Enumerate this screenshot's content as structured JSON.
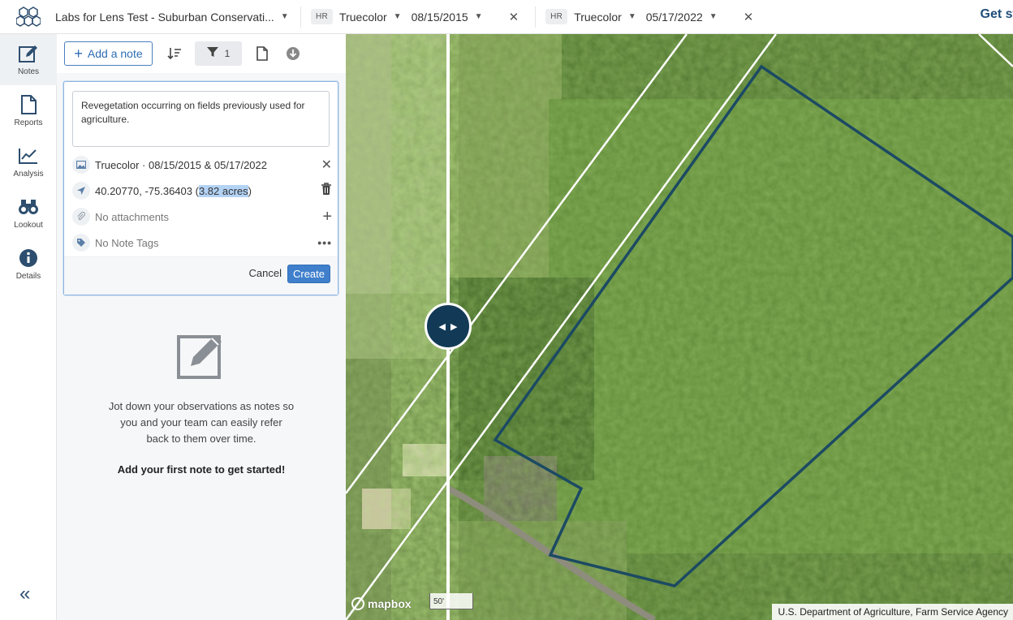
{
  "header": {
    "project_name": "Labs for Lens Test - Suburban Conservati...",
    "get_started": "Get star",
    "layers": [
      {
        "badge": "HR",
        "name": "Truecolor",
        "date": "08/15/2015"
      },
      {
        "badge": "HR",
        "name": "Truecolor",
        "date": "05/17/2022"
      }
    ]
  },
  "rail": {
    "items": [
      {
        "label": "Notes",
        "icon": "pencil-square-icon",
        "active": true
      },
      {
        "label": "Reports",
        "icon": "document-icon"
      },
      {
        "label": "Analysis",
        "icon": "line-chart-icon"
      },
      {
        "label": "Lookout",
        "icon": "binoculars-icon"
      },
      {
        "label": "Details",
        "icon": "info-icon"
      }
    ],
    "collapse_label": "«"
  },
  "notes": {
    "add_note_label": "Add a note",
    "filter_count": "1",
    "draft": {
      "text": "Revegetation occurring on fields previously used for agriculture.",
      "imagery": "Truecolor · 08/15/2015 & 05/17/2022",
      "coords": "40.20770, -75.36403 (",
      "area": "3.82 acres",
      "coords_close": ")",
      "attachments": "No attachments",
      "tags": "No Note Tags",
      "cancel_label": "Cancel",
      "create_label": "Create"
    },
    "empty_state": {
      "message": "Jot down your observations as notes so you and your team can easily refer back to them over time.",
      "cta": "Add your first note to get started!"
    }
  },
  "map": {
    "logo_text": "mapbox",
    "scale_label": "50'",
    "attribution": "U.S. Department of Agriculture, Farm Service Agency",
    "boundary_color": "#1c4a63",
    "accent": "#3f7fcc"
  }
}
